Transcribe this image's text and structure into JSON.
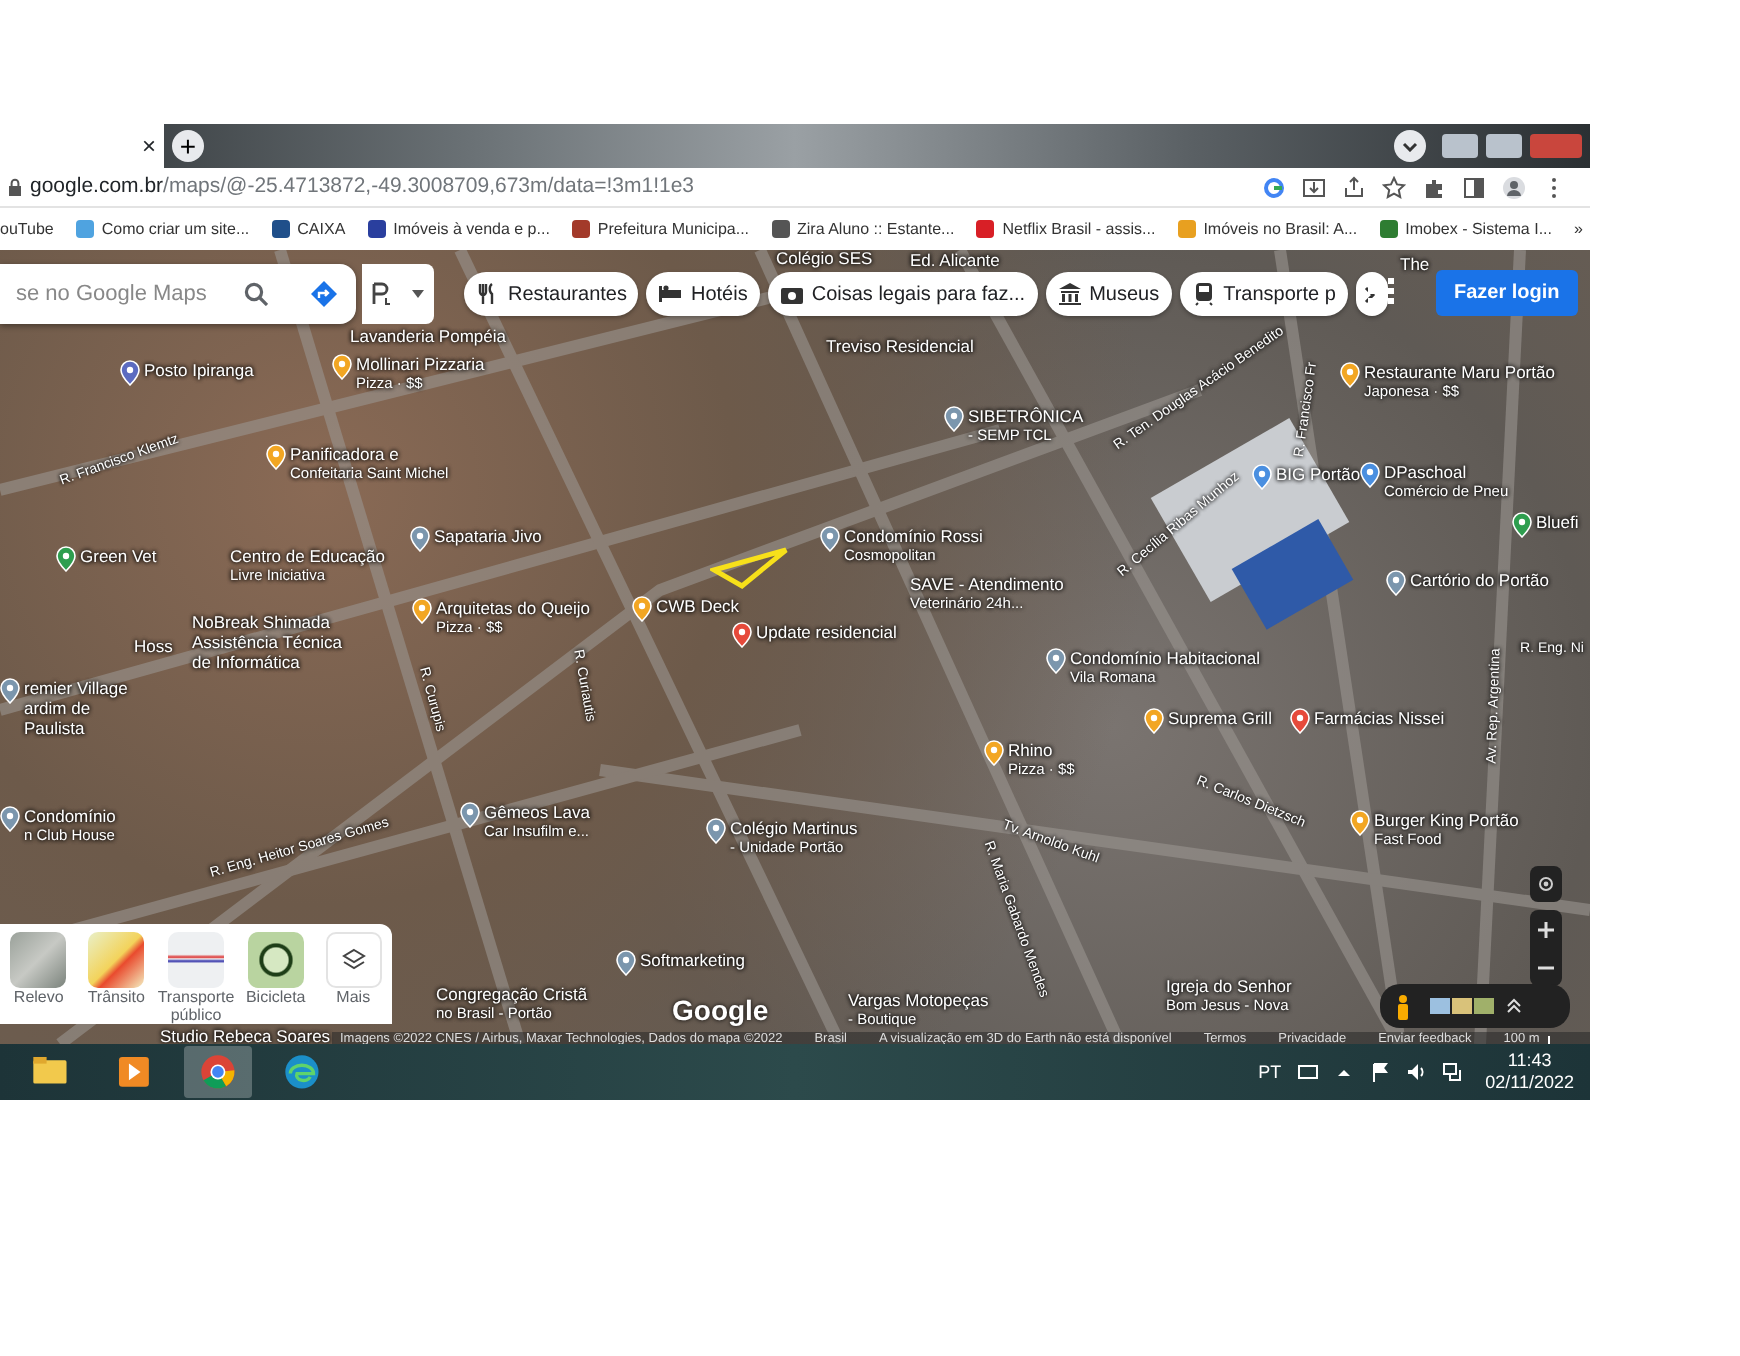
{
  "browser": {
    "tab_close": "×",
    "new_tab": "+",
    "url_domain": "google.com.br",
    "url_path": "/maps/@-25.4713872,-49.3008709,673m/data=!3m1!1e3",
    "bookmarks": [
      {
        "label": "ouTube"
      },
      {
        "label": "Como criar um site...",
        "color": "#4fa3e0"
      },
      {
        "label": "CAIXA",
        "color": "#1f4f8a"
      },
      {
        "label": "Imóveis à venda e p...",
        "color": "#2a3f9e"
      },
      {
        "label": "Prefeitura Municipa...",
        "color": "#a33a2a"
      },
      {
        "label": "Zira Aluno :: Estante...",
        "color": "#555555"
      },
      {
        "label": "Netflix Brasil - assis...",
        "color": "#d81f26"
      },
      {
        "label": "Imóveis no Brasil: A...",
        "color": "#e8a020"
      },
      {
        "label": "Imobex - Sistema I...",
        "color": "#2e7d32"
      }
    ],
    "bookmarks_more": "»"
  },
  "maps": {
    "search": {
      "placeholder": "se no Google Maps"
    },
    "chips": [
      "Restaurantes",
      "Hotéis",
      "Coisas legais para faz...",
      "Museus",
      "Transporte p"
    ],
    "login": "Fazer login",
    "places": [
      {
        "lines": [
          "Colégio SES"
        ]
      },
      {
        "lines": [
          "Ed. Alicante"
        ]
      },
      {
        "lines": [
          "The"
        ]
      },
      {
        "lines": [
          "Lavanderia Pompéia"
        ]
      },
      {
        "lines": [
          "Posto Ipiranga"
        ],
        "color": "#5c6bc0"
      },
      {
        "lines": [
          "Mollinari Pizzaria",
          "Pizza · $$"
        ],
        "color": "#f2a623"
      },
      {
        "lines": [
          "Panificadora e",
          "Confeitaria Saint Michel"
        ],
        "color": "#f2a623"
      },
      {
        "lines": [
          "Sapataria Jivo"
        ],
        "color": "#7b96ad"
      },
      {
        "lines": [
          "Green Vet"
        ],
        "color": "#2e9e4f"
      },
      {
        "lines": [
          "Centro de Educação",
          "Livre Iniciativa"
        ]
      },
      {
        "lines": [
          "NoBreak Shimada",
          "Assistência Técnica",
          "de Informática"
        ]
      },
      {
        "lines": [
          "Arquitetas do Queijo",
          "Pizza · $$"
        ],
        "color": "#f2a623"
      },
      {
        "lines": [
          "CWB Deck"
        ],
        "color": "#f2a623"
      },
      {
        "lines": [
          "Hoss"
        ]
      },
      {
        "lines": [
          "Treviso Residencial"
        ]
      },
      {
        "lines": [
          "SIBETRÔNICA",
          "- SEMP TCL"
        ],
        "color": "#7b96ad"
      },
      {
        "lines": [
          "Condomínio Rossi",
          "Cosmopolitan"
        ],
        "color": "#7b96ad"
      },
      {
        "lines": [
          "SAVE - Atendimento",
          "Veterinário 24h..."
        ]
      },
      {
        "lines": [
          "Update residencial"
        ],
        "color": "#e64a3b"
      },
      {
        "lines": [
          "BIG Portão"
        ],
        "color": "#4a8fe0"
      },
      {
        "lines": [
          "Restaurante Maru Portão",
          "Japonesa · $$"
        ],
        "color": "#f2a623"
      },
      {
        "lines": [
          "DPaschoal",
          "Comércio de Pneu"
        ],
        "color": "#4a8fe0"
      },
      {
        "lines": [
          "Bluefi"
        ],
        "color": "#2e9e4f"
      },
      {
        "lines": [
          "Cartório do Portão"
        ],
        "color": "#7b96ad"
      },
      {
        "lines": [
          "remier Village",
          "ardim de",
          "Paulista"
        ],
        "color": "#7b96ad"
      },
      {
        "lines": [
          "Condomínio",
          "n Club House"
        ],
        "color": "#7b96ad"
      },
      {
        "lines": [
          "Gêmeos Lava",
          "Car Insufilm e..."
        ],
        "color": "#7b96ad"
      },
      {
        "lines": [
          "Colégio Martinus",
          "- Unidade Portão"
        ],
        "color": "#7b96ad"
      },
      {
        "lines": [
          "Condomínio Habitacional",
          "Vila Romana"
        ],
        "color": "#7b96ad"
      },
      {
        "lines": [
          "Suprema Grill"
        ],
        "color": "#f2a623"
      },
      {
        "lines": [
          "Farmácias Nissei"
        ],
        "color": "#e64a3b"
      },
      {
        "lines": [
          "Rhino",
          "Pizza · $$"
        ],
        "color": "#f2a623"
      },
      {
        "lines": [
          "Burger King Portão",
          "Fast Food"
        ],
        "color": "#f2a623"
      },
      {
        "lines": [
          "Softmarketing"
        ],
        "color": "#7b96ad"
      },
      {
        "lines": [
          "Congregação Cristã",
          "no Brasil - Portão"
        ]
      },
      {
        "lines": [
          "Vargas Motopeças",
          "- Boutique"
        ]
      },
      {
        "lines": [
          "Igreja do Senhor",
          "Bom Jesus - Nova"
        ]
      },
      {
        "lines": [
          "Studio Rebeca Soares"
        ]
      }
    ],
    "streets": [
      "R. Francisco Klemtz",
      "R. Ten. Douglas Acácio Benedito",
      "R. Cecília Ribas Munhoz",
      "R. Francisco Fr",
      "R. Curupis",
      "R. Curiautis",
      "R. Eng. Heitor Soares Gomes",
      "Tv. Arnoldo Kuhl",
      "R. Maria Gabardo Mendes",
      "R. Carlos Dietzsch",
      "Av. Rep. Argentina",
      "R. Eng. Ni"
    ],
    "logo": "Google",
    "layers": [
      {
        "kind": "terrain",
        "label": "Relevo"
      },
      {
        "kind": "traffic",
        "label": "Trânsito"
      },
      {
        "kind": "transit",
        "label": "Transporte público"
      },
      {
        "kind": "bike",
        "label": "Bicicleta"
      },
      {
        "kind": "more",
        "label": "Mais"
      }
    ],
    "attribution": [
      "Imagens ©2022 CNES / Airbus, Maxar Technologies, Dados do mapa ©2022",
      "Brasil",
      "A visualização em 3D do Earth não está disponível",
      "Termos",
      "Privacidade",
      "Enviar feedback"
    ],
    "scale": "100 m"
  },
  "taskbar": {
    "language": "PT",
    "time": "11:43",
    "date": "02/11/2022"
  }
}
